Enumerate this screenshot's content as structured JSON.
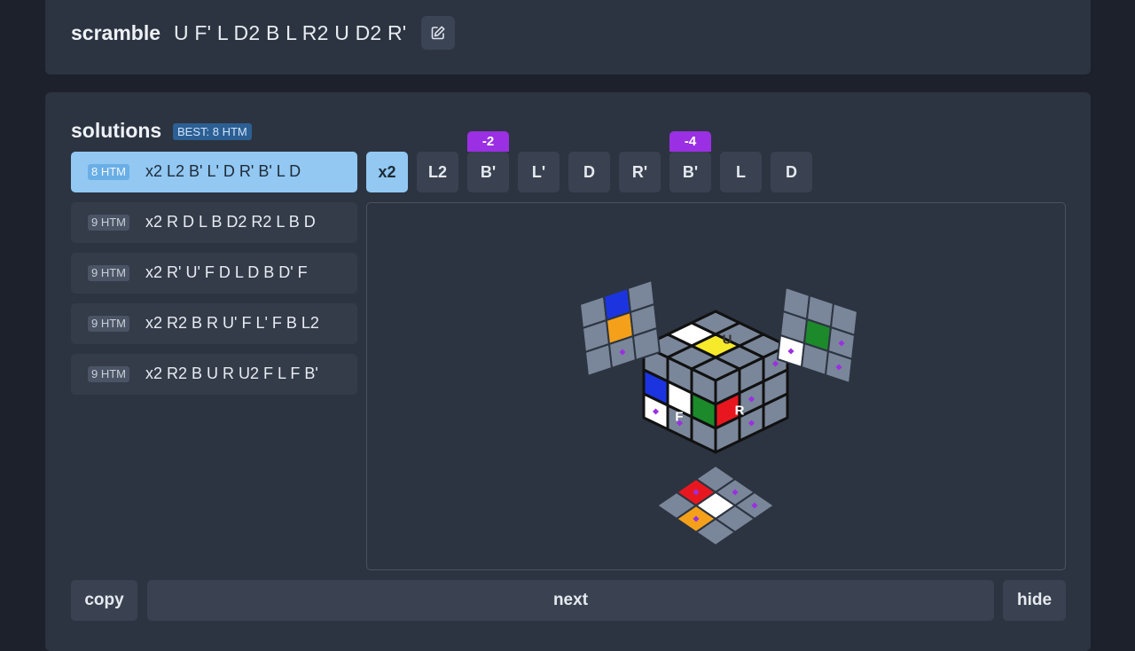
{
  "scramble": {
    "label": "scramble",
    "moves": "U F' L D2 B L R2 U D2 R'"
  },
  "solutions": {
    "title": "solutions",
    "best_badge": "BEST: 8 HTM",
    "items": [
      {
        "htm": "8 HTM",
        "moves": "x2 L2 B' L' D R' B' L D",
        "selected": true
      },
      {
        "htm": "9 HTM",
        "moves": "x2 R D L B D2 R2 L B D",
        "selected": false
      },
      {
        "htm": "9 HTM",
        "moves": "x2 R' U' F D L D B D' F",
        "selected": false
      },
      {
        "htm": "9 HTM",
        "moves": "x2 R2 B R U' F L' F B L2",
        "selected": false
      },
      {
        "htm": "9 HTM",
        "moves": "x2 R2 B U R U2 F L F B'",
        "selected": false
      }
    ]
  },
  "moves": [
    {
      "label": "x2",
      "active": true,
      "tag": ""
    },
    {
      "label": "L2",
      "active": false,
      "tag": ""
    },
    {
      "label": "B'",
      "active": false,
      "tag": "-2"
    },
    {
      "label": "L'",
      "active": false,
      "tag": ""
    },
    {
      "label": "D",
      "active": false,
      "tag": ""
    },
    {
      "label": "R'",
      "active": false,
      "tag": ""
    },
    {
      "label": "B'",
      "active": false,
      "tag": "-4"
    },
    {
      "label": "L",
      "active": false,
      "tag": ""
    },
    {
      "label": "D",
      "active": false,
      "tag": ""
    }
  ],
  "cube": {
    "face_letters": {
      "up": "U",
      "front": "F",
      "right": "R"
    },
    "colors": {
      "white": "#ffffff",
      "yellow": "#f7ea2a",
      "red": "#e8171f",
      "green": "#1c8a2b",
      "blue": "#1b34e0",
      "orange": "#f5a01a",
      "gray": "#7a8699",
      "highlight": "#9b2fe3"
    }
  },
  "buttons": {
    "copy": "copy",
    "next": "next",
    "hide": "hide"
  }
}
